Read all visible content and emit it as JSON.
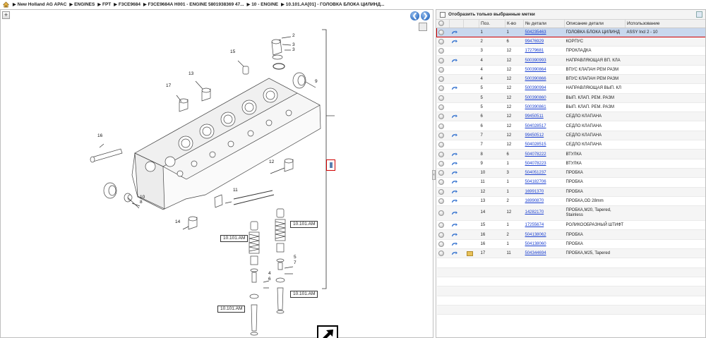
{
  "breadcrumb": [
    "New Holland AG APAC",
    "ENGINES",
    "FPT",
    "F3CE9684",
    "F3CE9684A H001 - ENGINE 5801938369 47...",
    "10 - ENGINE",
    "10.101.AA[01] - ГОЛОВКА БЛОКА ЦИЛИНД..."
  ],
  "filter": {
    "label": "Отобразить только выбранные метки"
  },
  "columns": {
    "pos": "Поз.",
    "qty": "К-во",
    "partno": "№ детали",
    "desc": "Описание детали",
    "usage": "Использование"
  },
  "rows": [
    {
      "pos": "1",
      "qty": "1",
      "partno": "504235463",
      "desc": "ГОЛОВКА БЛОКА ЦИЛИНД",
      "usage": "ASSY Incl 2 - 10",
      "arrow": true,
      "selected": true
    },
    {
      "pos": "2",
      "qty": "6",
      "partno": "99476929",
      "desc": "КОРПУС",
      "usage": "",
      "arrow": true
    },
    {
      "pos": "3",
      "qty": "12",
      "partno": "17279681",
      "desc": "ПРОКЛАДКА",
      "usage": "",
      "arrow": false
    },
    {
      "pos": "4",
      "qty": "12",
      "partno": "500390993",
      "desc": "НАПРАВЛЯЮЩАЯ ВП. КЛА",
      "usage": "",
      "arrow": true
    },
    {
      "pos": "4",
      "qty": "12",
      "partno": "500390864",
      "desc": "ВПУС КЛАПАН РЕМ РАЗМ",
      "usage": "",
      "arrow": false
    },
    {
      "pos": "4",
      "qty": "12",
      "partno": "500390866",
      "desc": "ВПУС КЛАПАН РЕМ РАЗМ",
      "usage": "",
      "arrow": false
    },
    {
      "pos": "5",
      "qty": "12",
      "partno": "500390994",
      "desc": "НАПРАВЛЯЮЩАЯ ВЫП. КЛ",
      "usage": "",
      "arrow": true
    },
    {
      "pos": "5",
      "qty": "12",
      "partno": "500390860",
      "desc": "ВЫП. КЛАП. РЕМ. РАЗМ",
      "usage": "",
      "arrow": false
    },
    {
      "pos": "5",
      "qty": "12",
      "partno": "500390861",
      "desc": "ВЫП. КЛАП. РЕМ. РАЗМ",
      "usage": "",
      "arrow": false
    },
    {
      "pos": "6",
      "qty": "12",
      "partno": "99450511",
      "desc": "СЕДЛО КЛАПАНА",
      "usage": "",
      "arrow": true
    },
    {
      "pos": "6",
      "qty": "12",
      "partno": "504028517",
      "desc": "СЕДЛО КЛАПАНА",
      "usage": "",
      "arrow": false
    },
    {
      "pos": "7",
      "qty": "12",
      "partno": "99450512",
      "desc": "СЕДЛО КЛАПАНА",
      "usage": "",
      "arrow": true
    },
    {
      "pos": "7",
      "qty": "12",
      "partno": "504028515",
      "desc": "СЕДЛО КЛАПАНА",
      "usage": "",
      "arrow": false
    },
    {
      "pos": "8",
      "qty": "6",
      "partno": "504078222",
      "desc": "ВТУЛКА",
      "usage": "",
      "arrow": true
    },
    {
      "pos": "9",
      "qty": "1",
      "partno": "504078223",
      "desc": "ВТУЛКА",
      "usage": "",
      "arrow": true
    },
    {
      "pos": "10",
      "qty": "3",
      "partno": "504051237",
      "desc": "ПРОБКА",
      "usage": "",
      "arrow": true
    },
    {
      "pos": "11",
      "qty": "1",
      "partno": "504182706",
      "desc": "ПРОБКА",
      "usage": "",
      "arrow": true
    },
    {
      "pos": "12",
      "qty": "1",
      "partno": "16991370",
      "desc": "ПРОБКА",
      "usage": "",
      "arrow": true
    },
    {
      "pos": "13",
      "qty": "2",
      "partno": "16990870",
      "desc": "ПРОБКА,OD 28mm",
      "usage": "",
      "arrow": true
    },
    {
      "pos": "14",
      "qty": "12",
      "partno": "14282170",
      "desc": "ПРОБКА,M20, Tapered, Stainless",
      "usage": "",
      "arrow": true,
      "tall": true
    },
    {
      "pos": "15",
      "qty": "1",
      "partno": "17255674",
      "desc": "РОЛИКООБРАЗНЫЙ ШТИФТ",
      "usage": "",
      "arrow": true
    },
    {
      "pos": "16",
      "qty": "2",
      "partno": "504138062",
      "desc": "ПРОБКА",
      "usage": "",
      "arrow": true
    },
    {
      "pos": "16",
      "qty": "1",
      "partno": "504138060",
      "desc": "ПРОБКА",
      "usage": "",
      "arrow": true
    },
    {
      "pos": "17",
      "qty": "11",
      "partno": "504344694",
      "desc": "ПРОБКА,M25, Tapered",
      "usage": "",
      "arrow": true,
      "folder": true
    }
  ],
  "diagram": {
    "callouts": [
      "2",
      "3",
      "3",
      "9",
      "15",
      "13",
      "17",
      "16",
      "12",
      "11",
      "10",
      "8",
      "14",
      "5",
      "7",
      "4",
      "6"
    ],
    "ref_labels": [
      "10.101.AM",
      "10.101.AM",
      "10.101.AM",
      "10.101.AM"
    ]
  },
  "colors": {
    "link": "#1a3fd0",
    "highlight": "#d00000",
    "selected_row": "#c8d8ee"
  }
}
